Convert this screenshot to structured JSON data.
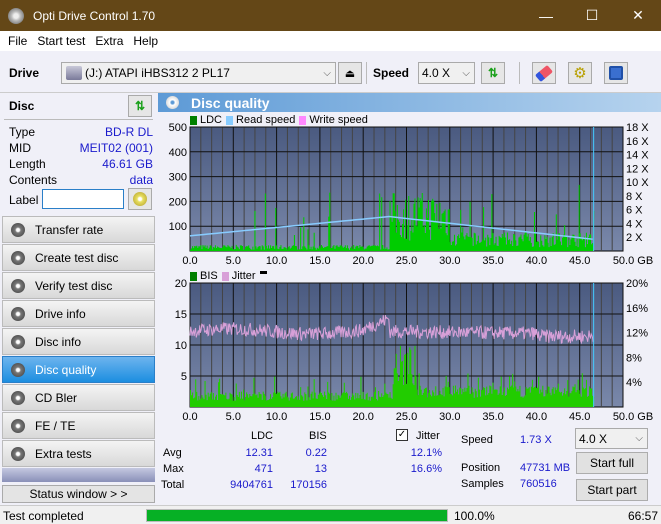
{
  "window": {
    "title": "Opti Drive Control 1.70",
    "minimize": "—",
    "maximize": "☐",
    "close": "✕"
  },
  "menu": [
    "File",
    "Start test",
    "Extra",
    "Help"
  ],
  "toolbar": {
    "drive_label": "Drive",
    "drive_value": "(J:)  ATAPI iHBS312   2 PL17",
    "speed_label": "Speed",
    "speed_value": "4.0 X"
  },
  "disc": {
    "title": "Disc",
    "rows": [
      {
        "k": "Type",
        "v": "BD-R DL"
      },
      {
        "k": "MID",
        "v": "MEIT02 (001)"
      },
      {
        "k": "Length",
        "v": "46.61 GB"
      },
      {
        "k": "Contents",
        "v": "data"
      }
    ],
    "label_key": "Label",
    "label_value": ""
  },
  "nav": [
    {
      "label": "Transfer rate"
    },
    {
      "label": "Create test disc"
    },
    {
      "label": "Verify test disc"
    },
    {
      "label": "Drive info"
    },
    {
      "label": "Disc info"
    },
    {
      "label": "Disc quality",
      "active": true
    },
    {
      "label": "CD Bler"
    },
    {
      "label": "FE / TE"
    },
    {
      "label": "Extra tests"
    }
  ],
  "status_window": "Status window > >",
  "panel": {
    "title": "Disc quality"
  },
  "chart_data": [
    {
      "type": "bar",
      "title": "LDC",
      "legend": [
        "LDC",
        "Read speed",
        "Write speed"
      ],
      "colors": {
        "LDC": "#00cc00",
        "Read speed": "#88ccff",
        "Write speed": "#ff88ff"
      },
      "xlim": [
        0,
        50
      ],
      "ylim": [
        0,
        500
      ],
      "y2lim": [
        0,
        18
      ],
      "x_ticks": [
        "0.0",
        "5.0",
        "10.0",
        "15.0",
        "20.0",
        "25.0",
        "30.0",
        "35.0",
        "40.0",
        "45.0",
        "50.0 GB"
      ],
      "y_ticks": [
        "500",
        "400",
        "300",
        "200",
        "100"
      ],
      "y2_ticks": [
        "18 X",
        "16 X",
        "14 X",
        "12 X",
        "10 X",
        "8 X",
        "6 X",
        "4 X",
        "2 X"
      ],
      "data_end_gb": 46.61,
      "read_speed_start_x": 2.2,
      "read_speed_peak_x": 5.0,
      "read_speed_end_x": 1.7
    },
    {
      "type": "bar",
      "title": "BIS / Jitter",
      "legend": [
        "BIS",
        "Jitter"
      ],
      "colors": {
        "BIS": "#00cc00",
        "Jitter": "#d8a0d8"
      },
      "xlim": [
        0,
        50
      ],
      "ylim": [
        0,
        20
      ],
      "y2lim": [
        0,
        20
      ],
      "x_ticks": [
        "0.0",
        "5.0",
        "10.0",
        "15.0",
        "20.0",
        "25.0",
        "30.0",
        "35.0",
        "40.0",
        "45.0",
        "50.0 GB"
      ],
      "y_ticks": [
        "20",
        "15",
        "10",
        "5"
      ],
      "y2_ticks": [
        "20%",
        "16%",
        "12%",
        "8%",
        "4%"
      ],
      "data_end_gb": 46.61
    }
  ],
  "stats": {
    "col_ldc": "LDC",
    "col_bis": "BIS",
    "jitter_label": "Jitter",
    "jitter_checked": true,
    "rows": [
      {
        "k": "Avg",
        "ldc": "12.31",
        "bis": "0.22",
        "jit": "12.1%"
      },
      {
        "k": "Max",
        "ldc": "471",
        "bis": "13",
        "jit": "16.6%"
      },
      {
        "k": "Total",
        "ldc": "9404761",
        "bis": "170156",
        "jit": ""
      }
    ],
    "speed_label": "Speed",
    "speed_value": "1.73 X",
    "position_label": "Position",
    "position_value": "47731 MB",
    "samples_label": "Samples",
    "samples_value": "760516",
    "speed_select": "4.0 X",
    "start_full": "Start full",
    "start_part": "Start part"
  },
  "statusbar": {
    "text": "Test completed",
    "progress": 100,
    "progress_text": "100.0%",
    "time": "66:57"
  }
}
